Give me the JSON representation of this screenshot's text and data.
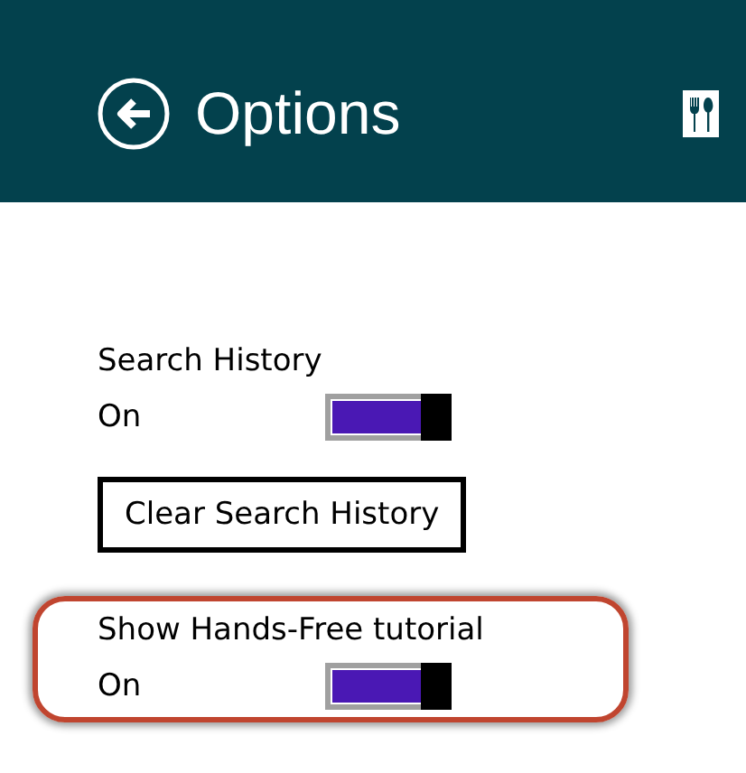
{
  "header": {
    "title": "Options"
  },
  "settings": [
    {
      "kind": "toggle",
      "label": "Search History",
      "state_text": "On",
      "on": true,
      "highlighted": false
    },
    {
      "kind": "button",
      "label": "Clear Search History",
      "highlighted": false
    },
    {
      "kind": "toggle",
      "label": "Show Hands-Free tutorial",
      "state_text": "On",
      "on": true,
      "highlighted": true
    }
  ]
}
